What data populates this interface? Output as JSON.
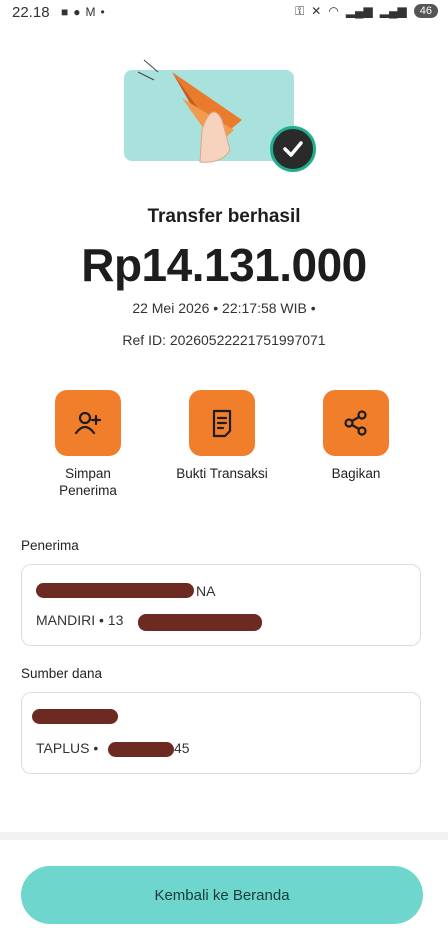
{
  "status_bar": {
    "time": "22.18",
    "battery": "46"
  },
  "result": {
    "title": "Transfer berhasil",
    "amount": "Rp14.131.000",
    "datetime": "22 Mei 2026 • 22:17:58 WIB •",
    "ref_id": "Ref ID: 20260522221751997071"
  },
  "actions": [
    {
      "label": "Simpan\nPenerima",
      "icon": "add-user-icon"
    },
    {
      "label": "Bukti Transaksi",
      "icon": "receipt-icon"
    },
    {
      "label": "Bagikan",
      "icon": "share-icon"
    }
  ],
  "recipient": {
    "section_label": "Penerima",
    "name_visible": "NA",
    "bank_prefix": "MANDIRI • 13"
  },
  "source": {
    "section_label": "Sumber dana",
    "account_prefix": "TAPLUS •",
    "account_suffix": "45"
  },
  "home_button_label": "Kembali ke Beranda",
  "colors": {
    "accent_orange": "#f07e2a",
    "teal_button": "#6ed6cc",
    "hero_bg": "#a9e2dc"
  }
}
